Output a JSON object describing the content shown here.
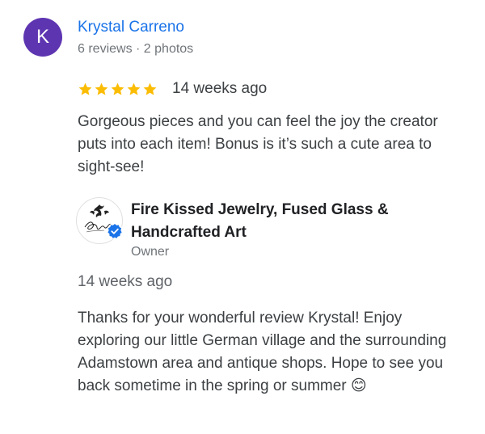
{
  "review": {
    "avatar_initial": "K",
    "avatar_color": "#5e35b1",
    "reviewer_name": "Krystal Carreno",
    "reviewer_meta": "6 reviews · 2 photos",
    "rating": 5,
    "max_rating": 5,
    "star_color": "#fbbc04",
    "time": "14 weeks ago",
    "text": "Gorgeous pieces and you can feel the joy the creator puts into each item! Bonus is it’s such a cute area to sight-see!"
  },
  "owner_response": {
    "owner_name": "Fire Kissed Jewelry, Fused Glass & Handcrafted Art",
    "role": "Owner",
    "verified_badge_icon": "verified-check-icon",
    "badge_color": "#1a73e8",
    "time": "14 weeks ago",
    "text": "Thanks for your wonderful review Krystal! Enjoy exploring our little German village and the surrounding Adamstown area and antique shops. Hope to see you back sometime in the spring or summer 😊"
  }
}
